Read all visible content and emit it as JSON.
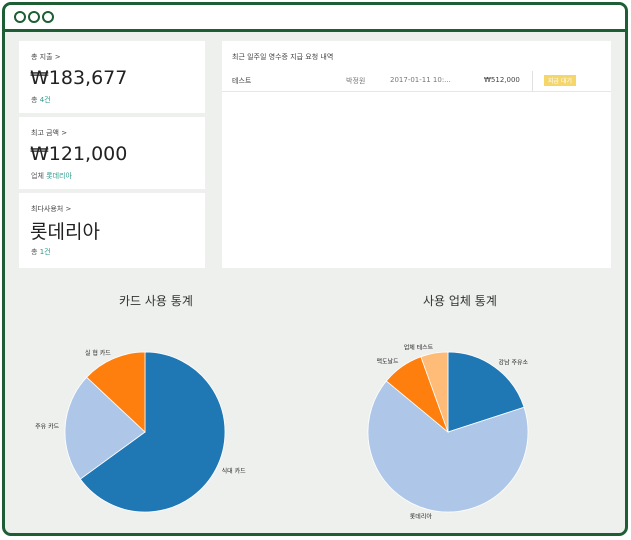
{
  "summary": {
    "total_spend": {
      "label": "총 지출",
      "amount": "₩183,677",
      "sub_prefix": "총",
      "sub_value": "4건"
    },
    "top_amount": {
      "label": "최고 금액",
      "amount": "₩121,000",
      "sub_prefix": "업체",
      "sub_value": "롯데리아"
    },
    "top_user": {
      "label": "최다사용처",
      "name": "롯데리아",
      "sub_prefix": "총",
      "sub_value": "1건"
    }
  },
  "recent": {
    "title": "최근 일주일 영수증 지급 요청 내역",
    "rows": [
      {
        "title": "테스트",
        "requester": "박정원",
        "date": "2017-01-11 10:...",
        "amount": "₩512,000",
        "status": "지급 대기"
      }
    ]
  },
  "charts_titles": {
    "card": "카드 사용 통계",
    "vendor": "사용 업체 통계"
  },
  "colors": {
    "dark_blue": "#1f77b4",
    "light_blue": "#aec7e8",
    "orange": "#ff7f0e",
    "light_orange": "#ffbb78",
    "border": "#1e5e34",
    "badge": "#f5d66a"
  },
  "chart_data": [
    {
      "type": "pie",
      "title": "카드 사용 통계",
      "slices": [
        {
          "label": "식대 카드",
          "value": 65,
          "color": "#1f77b4"
        },
        {
          "label": "주유 카드",
          "value": 22,
          "color": "#aec7e8"
        },
        {
          "label": "실 협 카드",
          "value": 13,
          "color": "#ff7f0e"
        }
      ]
    },
    {
      "type": "pie",
      "title": "사용 업체 통계",
      "slices": [
        {
          "label": "강남 주유소",
          "value": 20,
          "color": "#1f77b4"
        },
        {
          "label": "롯데리아",
          "value": 66,
          "color": "#aec7e8"
        },
        {
          "label": "맥도날드",
          "value": 8.5,
          "color": "#ff7f0e"
        },
        {
          "label": "업체 테스트",
          "value": 5.5,
          "color": "#ffbb78"
        }
      ]
    }
  ]
}
